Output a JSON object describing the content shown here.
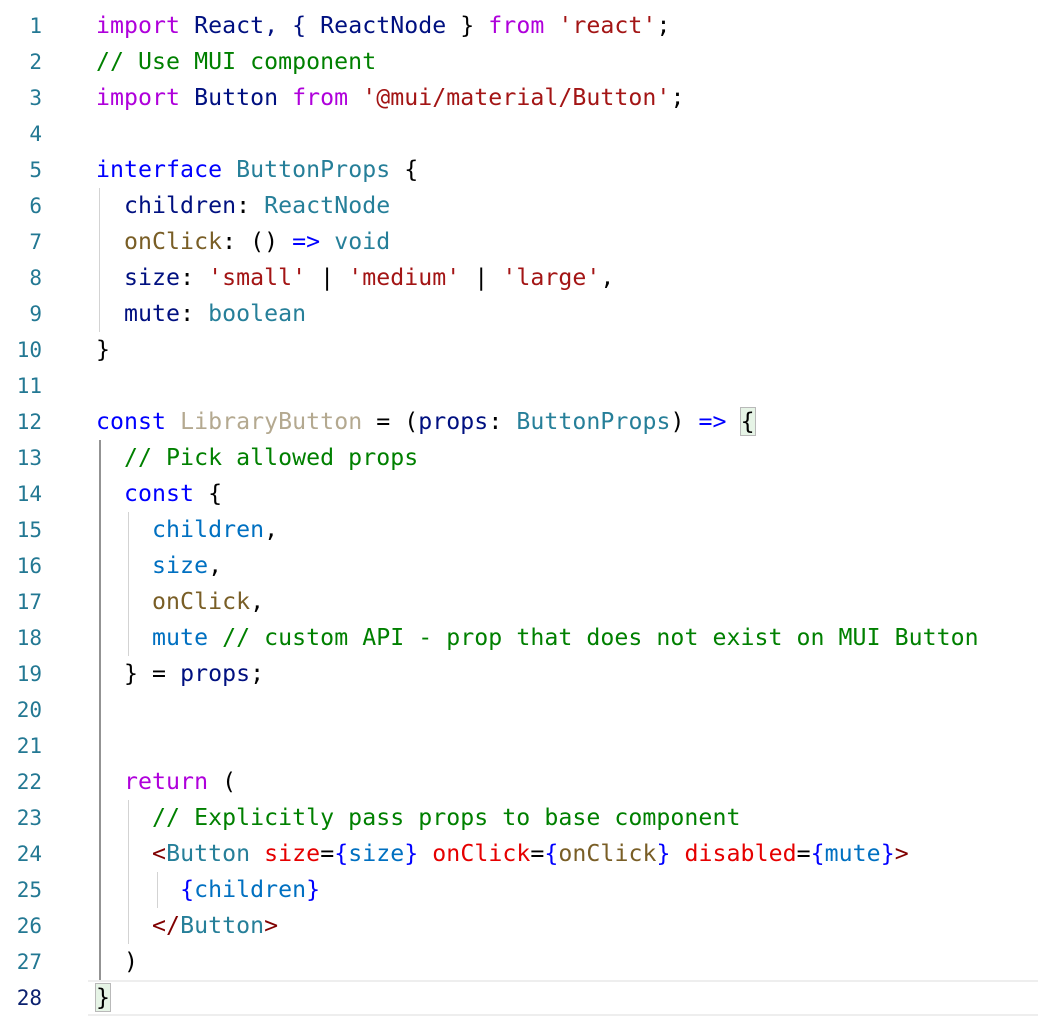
{
  "editor": {
    "current_line": 28,
    "lines": [
      {
        "n": "1",
        "tokens": [
          [
            "import",
            "t-kw-purple"
          ],
          [
            " React, { ",
            "t-dkblue"
          ],
          [
            "ReactNode",
            "t-dkblue"
          ],
          [
            " } ",
            "t-default"
          ],
          [
            "from",
            "t-kw-purple"
          ],
          [
            " ",
            "t-default"
          ],
          [
            "'react'",
            "t-str"
          ],
          [
            ";",
            "t-default"
          ]
        ]
      },
      {
        "n": "2",
        "tokens": [
          [
            "// Use MUI component",
            "t-com"
          ]
        ]
      },
      {
        "n": "3",
        "tokens": [
          [
            "import",
            "t-kw-purple"
          ],
          [
            " ",
            "t-default"
          ],
          [
            "Button",
            "t-dkblue"
          ],
          [
            " ",
            "t-default"
          ],
          [
            "from",
            "t-kw-purple"
          ],
          [
            " ",
            "t-default"
          ],
          [
            "'@mui/material/Button'",
            "t-str"
          ],
          [
            ";",
            "t-default"
          ]
        ]
      },
      {
        "n": "4",
        "tokens": []
      },
      {
        "n": "5",
        "tokens": [
          [
            "interface",
            "t-kw-blue"
          ],
          [
            " ",
            "t-default"
          ],
          [
            "ButtonProps",
            "t-type"
          ],
          [
            " {",
            "t-default"
          ]
        ]
      },
      {
        "n": "6",
        "tokens": [
          [
            "  children",
            "t-dkblue"
          ],
          [
            ": ",
            "t-default"
          ],
          [
            "ReactNode",
            "t-type"
          ]
        ]
      },
      {
        "n": "7",
        "tokens": [
          [
            "  onClick",
            "t-func"
          ],
          [
            ": () ",
            "t-default"
          ],
          [
            "=>",
            "t-kw-blue"
          ],
          [
            " ",
            "t-default"
          ],
          [
            "void",
            "t-type"
          ]
        ]
      },
      {
        "n": "8",
        "tokens": [
          [
            "  size",
            "t-dkblue"
          ],
          [
            ": ",
            "t-default"
          ],
          [
            "'small'",
            "t-str"
          ],
          [
            " | ",
            "t-default"
          ],
          [
            "'medium'",
            "t-str"
          ],
          [
            " | ",
            "t-default"
          ],
          [
            "'large'",
            "t-str"
          ],
          [
            ",",
            "t-default"
          ]
        ]
      },
      {
        "n": "9",
        "tokens": [
          [
            "  mute",
            "t-dkblue"
          ],
          [
            ": ",
            "t-default"
          ],
          [
            "boolean",
            "t-type"
          ]
        ]
      },
      {
        "n": "10",
        "tokens": [
          [
            "}",
            "t-default"
          ]
        ]
      },
      {
        "n": "11",
        "tokens": []
      },
      {
        "n": "12",
        "tokens": [
          [
            "const",
            "t-kw-decl"
          ],
          [
            " ",
            "t-default"
          ],
          [
            "LibraryButton",
            "t-unused"
          ],
          [
            " = (",
            "t-default"
          ],
          [
            "props",
            "t-dkblue"
          ],
          [
            ": ",
            "t-default"
          ],
          [
            "ButtonProps",
            "t-type"
          ],
          [
            ") ",
            "t-default"
          ],
          [
            "=>",
            "t-kw-blue"
          ],
          [
            " ",
            "t-default"
          ],
          [
            "{",
            "bracket"
          ]
        ]
      },
      {
        "n": "13",
        "tokens": [
          [
            "  // Pick allowed props",
            "t-com"
          ]
        ]
      },
      {
        "n": "14",
        "tokens": [
          [
            "  const",
            "t-kw-decl"
          ],
          [
            " {",
            "t-default"
          ]
        ]
      },
      {
        "n": "15",
        "tokens": [
          [
            "    children",
            "t-blue"
          ],
          [
            ",",
            "t-default"
          ]
        ]
      },
      {
        "n": "16",
        "tokens": [
          [
            "    size",
            "t-blue"
          ],
          [
            ",",
            "t-default"
          ]
        ]
      },
      {
        "n": "17",
        "tokens": [
          [
            "    onClick",
            "t-func"
          ],
          [
            ",",
            "t-default"
          ]
        ]
      },
      {
        "n": "18",
        "tokens": [
          [
            "    mute",
            "t-blue"
          ],
          [
            " ",
            "t-default"
          ],
          [
            "// custom API - prop that does not exist on MUI Button",
            "t-com"
          ]
        ]
      },
      {
        "n": "19",
        "tokens": [
          [
            "  } = ",
            "t-default"
          ],
          [
            "props",
            "t-dkblue"
          ],
          [
            ";",
            "t-default"
          ]
        ]
      },
      {
        "n": "20",
        "tokens": []
      },
      {
        "n": "21",
        "tokens": []
      },
      {
        "n": "22",
        "tokens": [
          [
            "  return",
            "t-kw-purple"
          ],
          [
            " (",
            "t-default"
          ]
        ]
      },
      {
        "n": "23",
        "tokens": [
          [
            "    // Explicitly pass props to base component",
            "t-com"
          ]
        ]
      },
      {
        "n": "24",
        "tokens": [
          [
            "    <",
            "t-tag"
          ],
          [
            "Button",
            "t-type"
          ],
          [
            " ",
            "t-default"
          ],
          [
            "size",
            "t-attr"
          ],
          [
            "=",
            "t-default"
          ],
          [
            "{",
            "t-kw-blue"
          ],
          [
            "size",
            "t-blue"
          ],
          [
            "}",
            "t-kw-blue"
          ],
          [
            " ",
            "t-default"
          ],
          [
            "onClick",
            "t-attr"
          ],
          [
            "=",
            "t-default"
          ],
          [
            "{",
            "t-kw-blue"
          ],
          [
            "onClick",
            "t-func"
          ],
          [
            "}",
            "t-kw-blue"
          ],
          [
            " ",
            "t-default"
          ],
          [
            "disabled",
            "t-attr"
          ],
          [
            "=",
            "t-default"
          ],
          [
            "{",
            "t-kw-blue"
          ],
          [
            "mute",
            "t-blue"
          ],
          [
            "}",
            "t-kw-blue"
          ],
          [
            ">",
            "t-tag"
          ]
        ]
      },
      {
        "n": "25",
        "tokens": [
          [
            "      ",
            "t-default"
          ],
          [
            "{",
            "t-kw-blue"
          ],
          [
            "children",
            "t-blue"
          ],
          [
            "}",
            "t-kw-blue"
          ]
        ]
      },
      {
        "n": "26",
        "tokens": [
          [
            "    </",
            "t-tag"
          ],
          [
            "Button",
            "t-type"
          ],
          [
            ">",
            "t-tag"
          ]
        ]
      },
      {
        "n": "27",
        "tokens": [
          [
            "  )",
            "t-default"
          ]
        ]
      },
      {
        "n": "28",
        "tokens": [
          [
            "}",
            "bracket"
          ]
        ]
      }
    ]
  }
}
